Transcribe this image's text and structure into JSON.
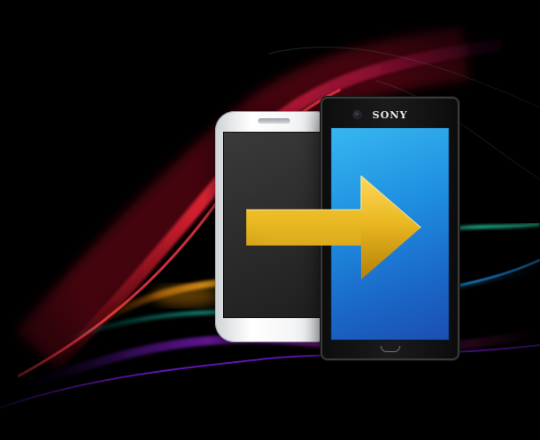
{
  "scene": {
    "brand_text": "SONY",
    "icons": [
      "generic-phone-icon",
      "sony-xperia-phone-icon",
      "transfer-arrow-icon"
    ],
    "colors": {
      "background": "#000000",
      "arrow_gold": "#e9b822",
      "new_phone_screen": "#1f8fe0",
      "old_phone_body": "#f1f2f3",
      "old_phone_screen": "#2b2b2b"
    }
  }
}
